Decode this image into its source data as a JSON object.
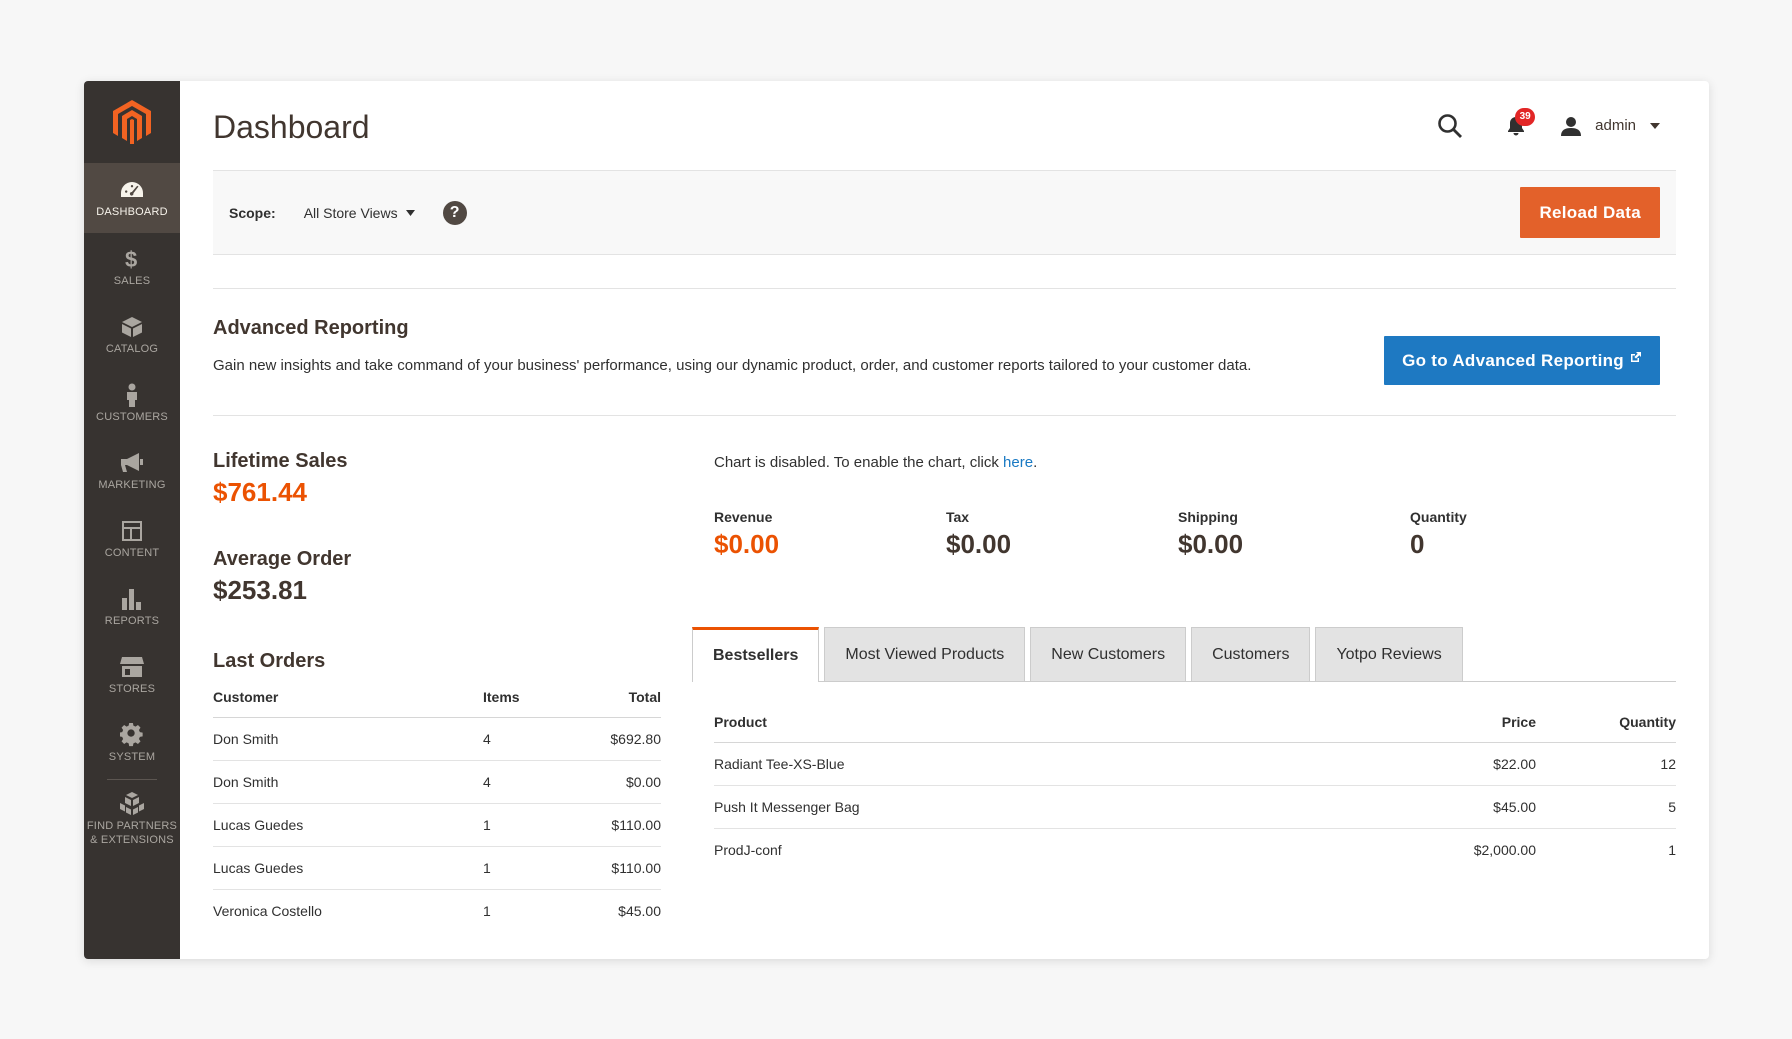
{
  "sidebar": {
    "items": [
      {
        "label": "Dashboard",
        "icon": "dashboard-icon"
      },
      {
        "label": "Sales",
        "icon": "dollar-icon"
      },
      {
        "label": "Catalog",
        "icon": "box-icon"
      },
      {
        "label": "Customers",
        "icon": "person-icon"
      },
      {
        "label": "Marketing",
        "icon": "megaphone-icon"
      },
      {
        "label": "Content",
        "icon": "layout-icon"
      },
      {
        "label": "Reports",
        "icon": "bar-chart-icon"
      },
      {
        "label": "Stores",
        "icon": "store-icon"
      },
      {
        "label": "System",
        "icon": "gear-icon"
      },
      {
        "label_line1": "Find Partners",
        "label_line2": "& Extensions",
        "icon": "cubes-icon"
      }
    ]
  },
  "header": {
    "title": "Dashboard",
    "notification_count": "39",
    "user_name": "admin"
  },
  "scope": {
    "label": "Scope:",
    "value": "All Store Views",
    "help": "?",
    "reload_label": "Reload Data"
  },
  "advanced_reporting": {
    "title": "Advanced Reporting",
    "text": "Gain new insights and take command of your business' performance, using our dynamic product, order, and customer reports tailored to your customer data.",
    "button_label": "Go to Advanced Reporting"
  },
  "stats": {
    "lifetime_sales_label": "Lifetime Sales",
    "lifetime_sales_value": "$761.44",
    "average_order_label": "Average Order",
    "average_order_value": "$253.81"
  },
  "last_orders": {
    "title": "Last Orders",
    "columns": [
      "Customer",
      "Items",
      "Total"
    ],
    "rows": [
      {
        "customer": "Don Smith",
        "items": "4",
        "total": "$692.80"
      },
      {
        "customer": "Don Smith",
        "items": "4",
        "total": "$0.00"
      },
      {
        "customer": "Lucas Guedes",
        "items": "1",
        "total": "$110.00"
      },
      {
        "customer": "Lucas Guedes",
        "items": "1",
        "total": "$110.00"
      },
      {
        "customer": "Veronica Costello",
        "items": "1",
        "total": "$45.00"
      }
    ]
  },
  "chart": {
    "note_prefix": "Chart is disabled. To enable the chart, click ",
    "note_link": "here",
    "note_suffix": "."
  },
  "totals": [
    {
      "label": "Revenue",
      "value": "$0.00"
    },
    {
      "label": "Tax",
      "value": "$0.00"
    },
    {
      "label": "Shipping",
      "value": "$0.00"
    },
    {
      "label": "Quantity",
      "value": "0"
    }
  ],
  "tabs": [
    "Bestsellers",
    "Most Viewed Products",
    "New Customers",
    "Customers",
    "Yotpo Reviews"
  ],
  "bestsellers": {
    "columns": [
      "Product",
      "Price",
      "Quantity"
    ],
    "rows": [
      {
        "product": "Radiant Tee-XS-Blue",
        "price": "$22.00",
        "quantity": "12"
      },
      {
        "product": "Push It Messenger Bag",
        "price": "$45.00",
        "quantity": "5"
      },
      {
        "product": "ProdJ-conf",
        "price": "$2,000.00",
        "quantity": "1"
      }
    ]
  },
  "colors": {
    "sidebar": "#373330",
    "accent_orange": "#eb5202",
    "button_orange": "#e3612a",
    "button_blue": "#1e79c2"
  }
}
